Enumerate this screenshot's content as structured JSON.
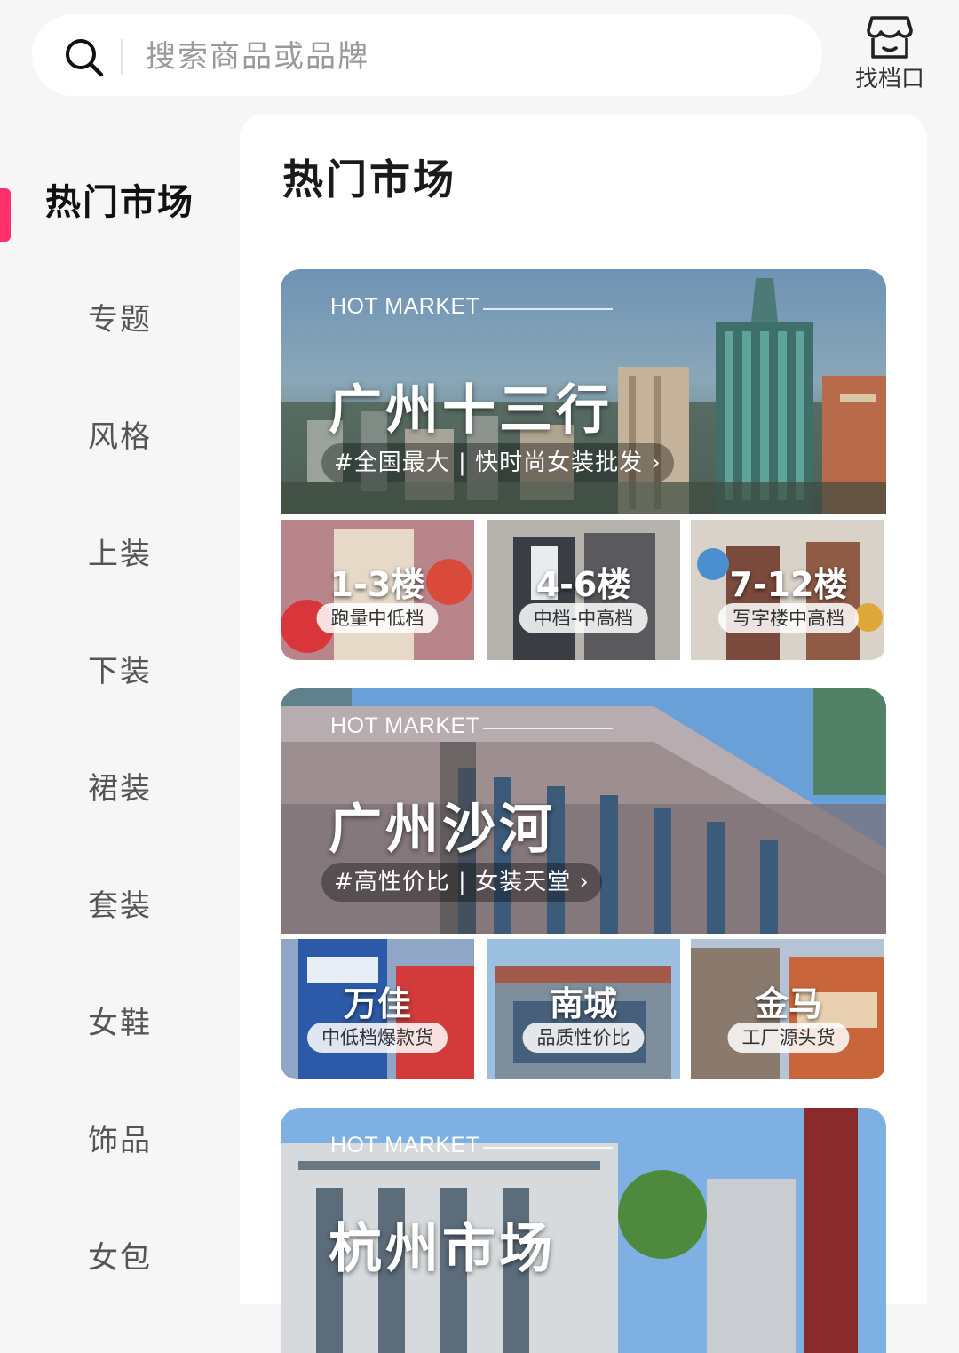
{
  "search": {
    "placeholder": "搜索商品或品牌"
  },
  "store_button": {
    "label": "找档口"
  },
  "sidebar": {
    "items": [
      {
        "label": "热门市场",
        "active": true
      },
      {
        "label": "专题"
      },
      {
        "label": "风格"
      },
      {
        "label": "上装"
      },
      {
        "label": "下装"
      },
      {
        "label": "裙装"
      },
      {
        "label": "套装"
      },
      {
        "label": "女鞋"
      },
      {
        "label": "饰品"
      },
      {
        "label": "女包"
      }
    ]
  },
  "accent_color": "#ff2f6b",
  "main": {
    "title": "热门市场",
    "markets": [
      {
        "badge": "HOT MARKET",
        "name": "广州十三行",
        "tagline": "#全国最大 | 快时尚女装批发 ›",
        "subs": [
          {
            "title": "1-3楼",
            "tag": "跑量中低档"
          },
          {
            "title": "4-6楼",
            "tag": "中档-中高档"
          },
          {
            "title": "7-12楼",
            "tag": "写字楼中高档"
          }
        ]
      },
      {
        "badge": "HOT MARKET",
        "name": "广州沙河",
        "tagline": "#高性价比 | 女装天堂 ›",
        "subs": [
          {
            "title": "万佳",
            "tag": "中低档爆款货"
          },
          {
            "title": "南城",
            "tag": "品质性价比"
          },
          {
            "title": "金马",
            "tag": "工厂源头货"
          }
        ]
      },
      {
        "badge": "HOT MARKET",
        "name": "杭州市场"
      }
    ]
  }
}
